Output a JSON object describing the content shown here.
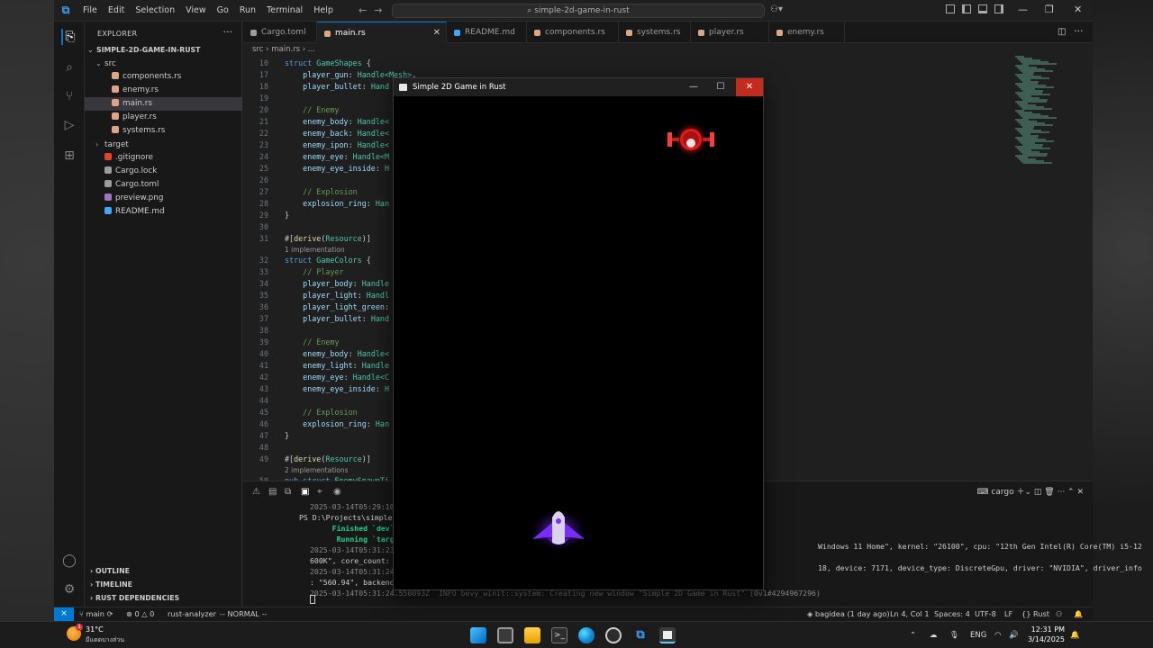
{
  "titlebar": {
    "menu": [
      "File",
      "Edit",
      "Selection",
      "View",
      "Go",
      "Run",
      "Terminal",
      "Help"
    ],
    "search": "simple-2d-game-in-rust"
  },
  "sidebar": {
    "header": "EXPLORER",
    "project": "SIMPLE-2D-GAME-IN-RUST",
    "items": [
      {
        "label": "src",
        "kind": "folder-open",
        "indent": 1
      },
      {
        "label": "components.rs",
        "kind": "rust",
        "indent": 2
      },
      {
        "label": "enemy.rs",
        "kind": "rust",
        "indent": 2
      },
      {
        "label": "main.rs",
        "kind": "rust",
        "indent": 2,
        "active": true
      },
      {
        "label": "player.rs",
        "kind": "rust",
        "indent": 2
      },
      {
        "label": "systems.rs",
        "kind": "rust",
        "indent": 2
      },
      {
        "label": "target",
        "kind": "folder",
        "indent": 1
      },
      {
        "label": ".gitignore",
        "kind": "git",
        "indent": 1
      },
      {
        "label": "Cargo.lock",
        "kind": "lock",
        "indent": 1
      },
      {
        "label": "Cargo.toml",
        "kind": "toml",
        "indent": 1
      },
      {
        "label": "preview.png",
        "kind": "image",
        "indent": 1
      },
      {
        "label": "README.md",
        "kind": "md",
        "indent": 1
      }
    ],
    "sections": [
      "OUTLINE",
      "TIMELINE",
      "RUST DEPENDENCIES"
    ]
  },
  "tabs": [
    {
      "label": "Cargo.toml",
      "icon_color": "#9c9c9c"
    },
    {
      "label": "main.rs",
      "icon_color": "#dea584",
      "active": true
    },
    {
      "label": "README.md",
      "icon_color": "#42a5f5"
    },
    {
      "label": "components.rs",
      "icon_color": "#dea584"
    },
    {
      "label": "systems.rs",
      "icon_color": "#dea584"
    },
    {
      "label": "player.rs",
      "icon_color": "#dea584"
    },
    {
      "label": "enemy.rs",
      "icon_color": "#dea584"
    }
  ],
  "breadcrumb": "src  ›  main.rs  ›  ...",
  "code": [
    {
      "n": "10",
      "parts": [
        [
          "kw",
          "struct "
        ],
        [
          "ty",
          "GameShapes "
        ],
        [
          "pun",
          "{"
        ]
      ]
    },
    {
      "n": "17",
      "parts": [
        [
          "fld",
          "    player_gun"
        ],
        [
          "pun",
          ": "
        ],
        [
          "ty",
          "Handle<Mesh>"
        ],
        [
          "pun",
          ","
        ]
      ]
    },
    {
      "n": "18",
      "parts": [
        [
          "fld",
          "    player_bullet"
        ],
        [
          "pun",
          ": "
        ],
        [
          "ty",
          "Hand"
        ]
      ]
    },
    {
      "n": "19",
      "parts": []
    },
    {
      "n": "20",
      "parts": [
        [
          "cm",
          "    // Enemy"
        ]
      ]
    },
    {
      "n": "21",
      "parts": [
        [
          "fld",
          "    enemy_body"
        ],
        [
          "pun",
          ": "
        ],
        [
          "ty",
          "Handle<"
        ]
      ]
    },
    {
      "n": "22",
      "parts": [
        [
          "fld",
          "    enemy_back"
        ],
        [
          "pun",
          ": "
        ],
        [
          "ty",
          "Handle<"
        ]
      ]
    },
    {
      "n": "23",
      "parts": [
        [
          "fld",
          "    enemy_ipon"
        ],
        [
          "pun",
          ": "
        ],
        [
          "ty",
          "Handle<"
        ]
      ]
    },
    {
      "n": "24",
      "parts": [
        [
          "fld",
          "    enemy_eye"
        ],
        [
          "pun",
          ": "
        ],
        [
          "ty",
          "Handle<M"
        ]
      ]
    },
    {
      "n": "25",
      "parts": [
        [
          "fld",
          "    enemy_eye_inside"
        ],
        [
          "pun",
          ": "
        ],
        [
          "ty",
          "H"
        ]
      ]
    },
    {
      "n": "26",
      "parts": []
    },
    {
      "n": "27",
      "parts": [
        [
          "cm",
          "    // Explosion"
        ]
      ]
    },
    {
      "n": "28",
      "parts": [
        [
          "fld",
          "    explosion_ring"
        ],
        [
          "pun",
          ": "
        ],
        [
          "ty",
          "Han"
        ]
      ]
    },
    {
      "n": "29",
      "parts": [
        [
          "pun",
          "}"
        ]
      ]
    },
    {
      "n": "30",
      "parts": []
    },
    {
      "n": "31",
      "parts": [
        [
          "pun",
          "#["
        ],
        [
          "attr",
          "derive"
        ],
        [
          "pun",
          "("
        ],
        [
          "ty",
          "Resource"
        ],
        [
          "pun",
          ")]"
        ]
      ],
      "lens": "1 implementation"
    },
    {
      "n": "32",
      "parts": [
        [
          "kw",
          "struct "
        ],
        [
          "ty",
          "GameColors "
        ],
        [
          "pun",
          "{"
        ]
      ]
    },
    {
      "n": "33",
      "parts": [
        [
          "cm",
          "    // Player"
        ]
      ]
    },
    {
      "n": "34",
      "parts": [
        [
          "fld",
          "    player_body"
        ],
        [
          "pun",
          ": "
        ],
        [
          "ty",
          "Handle"
        ]
      ]
    },
    {
      "n": "35",
      "parts": [
        [
          "fld",
          "    player_light"
        ],
        [
          "pun",
          ": "
        ],
        [
          "ty",
          "Handl"
        ]
      ]
    },
    {
      "n": "36",
      "parts": [
        [
          "fld",
          "    player_light_green"
        ],
        [
          "pun",
          ":"
        ]
      ]
    },
    {
      "n": "37",
      "parts": [
        [
          "fld",
          "    player_bullet"
        ],
        [
          "pun",
          ": "
        ],
        [
          "ty",
          "Hand"
        ]
      ]
    },
    {
      "n": "38",
      "parts": []
    },
    {
      "n": "39",
      "parts": [
        [
          "cm",
          "    // Enemy"
        ]
      ]
    },
    {
      "n": "40",
      "parts": [
        [
          "fld",
          "    enemy_body"
        ],
        [
          "pun",
          ": "
        ],
        [
          "ty",
          "Handle<"
        ]
      ]
    },
    {
      "n": "41",
      "parts": [
        [
          "fld",
          "    enemy_light"
        ],
        [
          "pun",
          ": "
        ],
        [
          "ty",
          "Handle"
        ]
      ]
    },
    {
      "n": "42",
      "parts": [
        [
          "fld",
          "    enemy_eye"
        ],
        [
          "pun",
          ": "
        ],
        [
          "ty",
          "Handle<C"
        ]
      ]
    },
    {
      "n": "43",
      "parts": [
        [
          "fld",
          "    enemy_eye_inside"
        ],
        [
          "pun",
          ": "
        ],
        [
          "ty",
          "H"
        ]
      ]
    },
    {
      "n": "44",
      "parts": []
    },
    {
      "n": "45",
      "parts": [
        [
          "cm",
          "    // Explosion"
        ]
      ]
    },
    {
      "n": "46",
      "parts": [
        [
          "fld",
          "    explosion_ring"
        ],
        [
          "pun",
          ": "
        ],
        [
          "ty",
          "Han"
        ]
      ]
    },
    {
      "n": "47",
      "parts": [
        [
          "pun",
          "}"
        ]
      ]
    },
    {
      "n": "48",
      "parts": []
    },
    {
      "n": "49",
      "parts": [
        [
          "pun",
          "#["
        ],
        [
          "attr",
          "derive"
        ],
        [
          "pun",
          "("
        ],
        [
          "ty",
          "Resource"
        ],
        [
          "pun",
          ")]"
        ]
      ],
      "lens": "2 implementations"
    },
    {
      "n": "50",
      "parts": [
        [
          "kw",
          "pub struct "
        ],
        [
          "ty",
          "EnemySpawnTi"
        ]
      ]
    }
  ],
  "terminal": {
    "profile": "cargo",
    "lines": [
      {
        "text": "2025-03-14T05:29:10.635636Z  INFO",
        "cls": "term-dim",
        "x": 12
      },
      {
        "text": "PS D:\\Projects\\simple-2d-game-in",
        "cls": "",
        "x": 0
      },
      {
        "text": "     Finished `dev` profile [unop",
        "cls": "term-green",
        "x": 12
      },
      {
        "text": "      Running `target\\debug\\simpl",
        "cls": "term-green",
        "x": 12
      },
      {
        "text": "2025-03-14T05:31:23.605078Z  INFO",
        "cls": "term-dim",
        "x": 12
      },
      {
        "text": "600K\", core_count: \"10\", memory:",
        "cls": "",
        "x": 12
      },
      {
        "text": "2025-03-14T05:31:24.000641Z  INFO",
        "cls": "term-dim",
        "x": 12
      },
      {
        "text": ": \"560.94\", backend: Vulkan }",
        "cls": "",
        "x": 12
      },
      {
        "text": "2025-03-14T05:31:24.550093Z  INFO bevy_winit::system: Creating new window \"Simple 2D Game in Rust\" (0v1#4294967296)",
        "cls": "term-dim",
        "x": 12
      }
    ],
    "right_lines": [
      "Windows 11 Home\", kernel: \"26100\", cpu: \"12th Gen Intel(R) Core(TM) i5-12",
      "18, device: 7171, device_type: DiscreteGpu, driver: \"NVIDIA\", driver_info"
    ]
  },
  "statusbar": {
    "branch": "main",
    "problems": "⊗ 0 △ 0",
    "analyzer": "rust-analyzer",
    "mode": "-- NORMAL --",
    "blame": "bagidea (1 day ago)",
    "position": "Ln 4, Col 1",
    "spaces": "Spaces: 4",
    "encoding": "UTF-8",
    "eol": "LF",
    "language": "Rust"
  },
  "game_window": {
    "title": "Simple 2D Game in Rust"
  },
  "taskbar": {
    "weather_temp": "31°C",
    "weather_text": "มีแดดบางส่วน",
    "weather_badge": "1",
    "lang": "ENG",
    "time": "12:31 PM",
    "date": "3/14/2025"
  },
  "colors": {
    "accent": "#0078d4",
    "close_red": "#c42b1c",
    "enemy_red": "#ff2a2a",
    "player_purple": "#7a2cff"
  }
}
